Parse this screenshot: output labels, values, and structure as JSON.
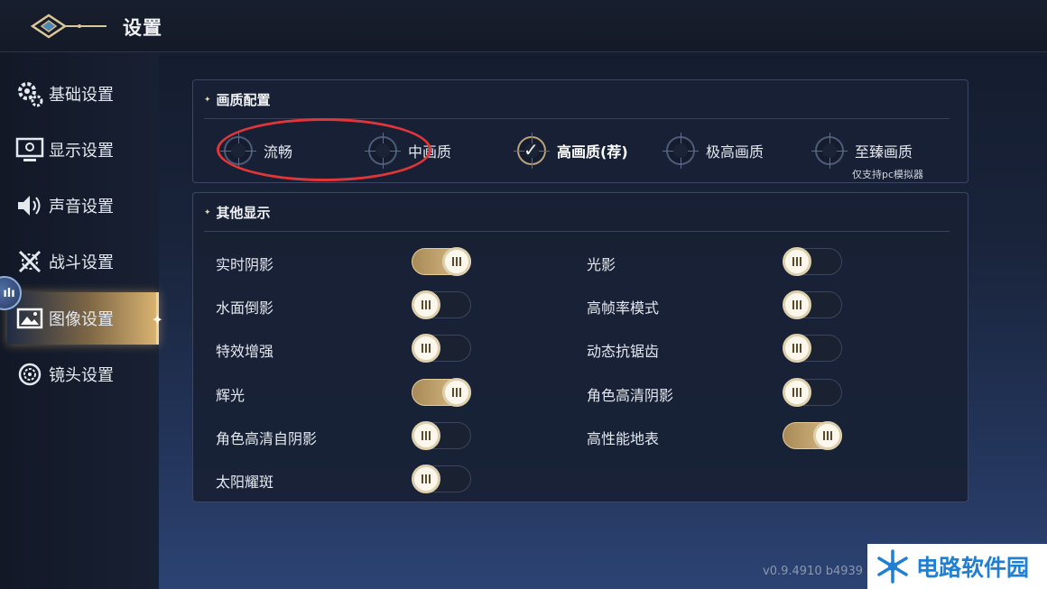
{
  "header": {
    "title": "设置"
  },
  "sidebar": {
    "items": [
      {
        "label": "基础设置",
        "icon": "gears-icon"
      },
      {
        "label": "显示设置",
        "icon": "monitor-icon"
      },
      {
        "label": "声音设置",
        "icon": "speaker-icon"
      },
      {
        "label": "战斗设置",
        "icon": "crossed-swords-icon"
      },
      {
        "label": "图像设置",
        "icon": "image-icon",
        "active": true
      },
      {
        "label": "镜头设置",
        "icon": "camera-lens-icon"
      }
    ],
    "floating_knob_text": "ılı"
  },
  "quality": {
    "title": "画质配置",
    "options": [
      {
        "label": "流畅",
        "selected": false
      },
      {
        "label": "中画质",
        "selected": false
      },
      {
        "label": "高画质(荐)",
        "selected": true
      },
      {
        "label": "极高画质",
        "selected": false
      },
      {
        "label": "至臻画质",
        "selected": false
      }
    ],
    "note": "仅支持pc模拟器"
  },
  "other": {
    "title": "其他显示",
    "rows": [
      {
        "label": "实时阴影",
        "on": true
      },
      {
        "label": "光影",
        "on": false
      },
      {
        "label": "水面倒影",
        "on": false
      },
      {
        "label": "高帧率模式",
        "on": false
      },
      {
        "label": "特效增强",
        "on": false
      },
      {
        "label": "动态抗锯齿",
        "on": false
      },
      {
        "label": "辉光",
        "on": true
      },
      {
        "label": "角色高清阴影",
        "on": false
      },
      {
        "label": "角色高清自阴影",
        "on": false
      },
      {
        "label": "高性能地表",
        "on": true
      },
      {
        "label": "太阳耀斑",
        "on": false
      }
    ]
  },
  "version": "v0.9.4910 b4939",
  "watermark": {
    "text": "电路软件园"
  },
  "colors": {
    "accent_gold": "#dfc18a",
    "annotation_red": "#e0363a",
    "watermark_blue": "#1e7fd3"
  }
}
